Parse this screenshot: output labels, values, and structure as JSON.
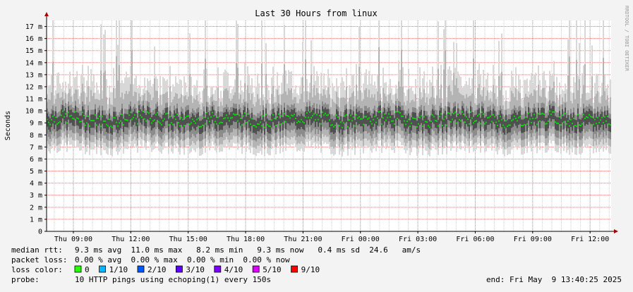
{
  "chart_data": {
    "type": "line",
    "title": "Last 30 Hours from linux",
    "ylabel": "Seconds",
    "xlabel": "",
    "watermark": "RRDTOOL / TOBI OETIKER",
    "y_ticks": [
      "0",
      "1 m",
      "2 m",
      "3 m",
      "4 m",
      "5 m",
      "6 m",
      "7 m",
      "8 m",
      "9 m",
      "10 m",
      "11 m",
      "12 m",
      "13 m",
      "14 m",
      "15 m",
      "16 m",
      "17 m"
    ],
    "ylim_ms": [
      0,
      17.5
    ],
    "x_ticks": [
      "Thu 09:00",
      "Thu 12:00",
      "Thu 15:00",
      "Thu 18:00",
      "Thu 21:00",
      "Fri 00:00",
      "Fri 03:00",
      "Fri 06:00",
      "Fri 09:00",
      "Fri 12:00"
    ],
    "x_range_hours_start_offset": -1.4,
    "x_range_hours_end_offset": 28.1,
    "series": [
      {
        "name": "median rtt",
        "color": "#00dd00",
        "typical_ms": 9.3
      }
    ],
    "smoke_colors": [
      "#d8d8d8",
      "#b4b4b4",
      "#8c8c8c",
      "#505050"
    ],
    "grid": true,
    "colors": {
      "background": "#ffffff",
      "outer": "#f3f3f3",
      "grid_minor": "#f0a0a0",
      "axis": "#000000",
      "arrow": "#aa0000"
    },
    "stats": {
      "median_rtt_label": "median rtt:",
      "median_rtt_values": "9.3 ms avg  11.0 ms max   8.2 ms min   9.3 ms now   0.4 ms sd  24.6   am/s",
      "packet_loss_label": "packet loss:",
      "packet_loss_values": "0.00 % avg  0.00 % max  0.00 % min  0.00 % now",
      "loss_color_label": "loss color:",
      "probe_label": "probe:",
      "probe_value": "10 HTTP pings using echoping(1) every 150s",
      "end_value": "end: Fri May  9 13:40:25 2025"
    },
    "loss_legend": [
      {
        "label": "0",
        "color": "#26ff00"
      },
      {
        "label": "1/10",
        "color": "#00b8ff"
      },
      {
        "label": "2/10",
        "color": "#0059ff"
      },
      {
        "label": "3/10",
        "color": "#5e00ff"
      },
      {
        "label": "4/10",
        "color": "#7e00ff"
      },
      {
        "label": "5/10",
        "color": "#dd00ff"
      },
      {
        "label": "9/10",
        "color": "#ff0000"
      }
    ]
  }
}
